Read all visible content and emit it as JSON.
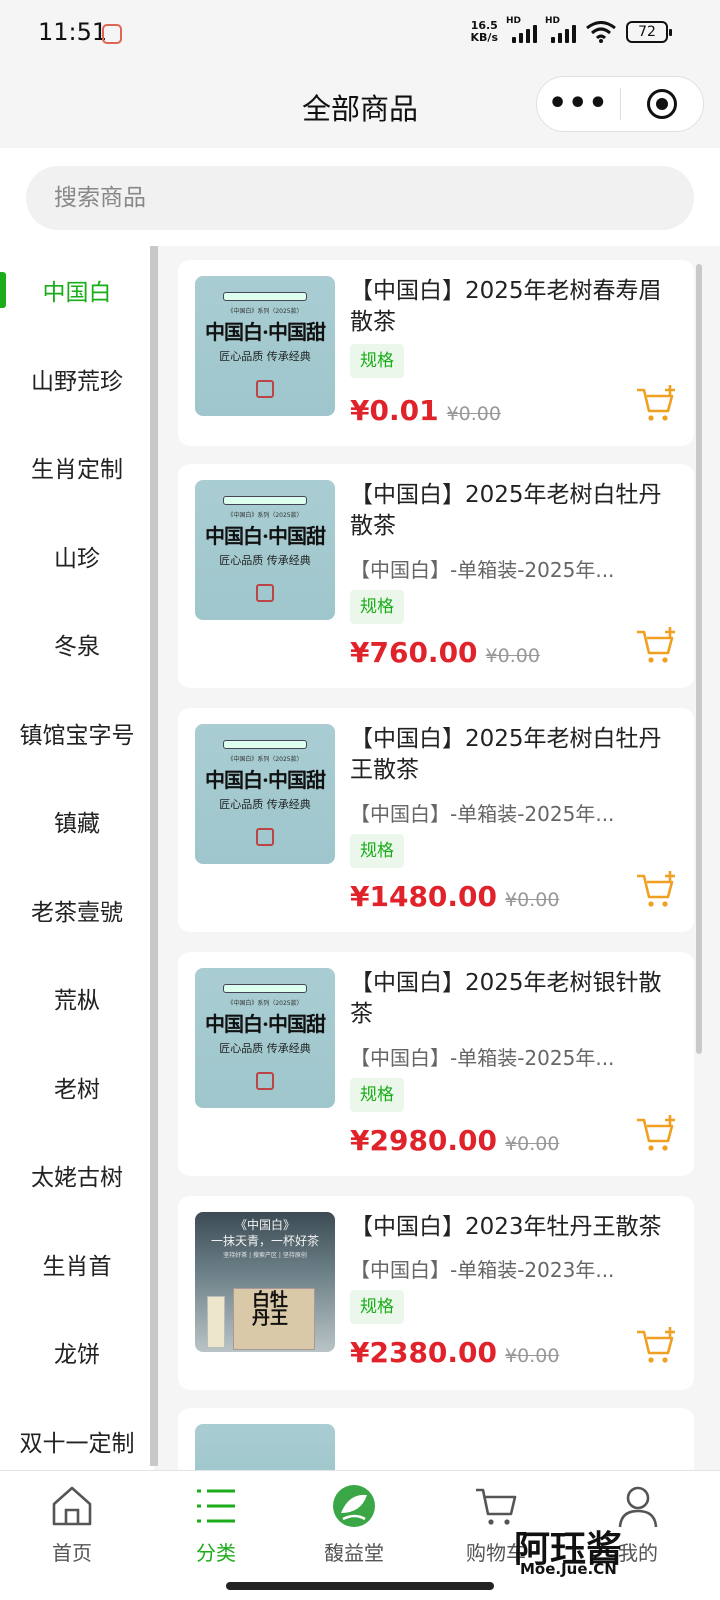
{
  "status_bar": {
    "time": "11:51",
    "net_speed_top": "16.5",
    "net_speed_bottom": "KB/s",
    "hd1": "HD",
    "hd2": "HD",
    "battery": "72"
  },
  "nav": {
    "title": "全部商品",
    "more_icon": "more-dots-icon",
    "close_icon": "target-icon"
  },
  "search": {
    "placeholder": "搜索商品"
  },
  "sidebar": {
    "items": [
      {
        "label": "中国白",
        "active": true
      },
      {
        "label": "山野荒珍"
      },
      {
        "label": "生肖定制"
      },
      {
        "label": "山珍"
      },
      {
        "label": "冬泉"
      },
      {
        "label": "镇馆宝字号"
      },
      {
        "label": "镇藏"
      },
      {
        "label": "老茶壹號"
      },
      {
        "label": "荒枞"
      },
      {
        "label": "老树"
      },
      {
        "label": "太姥古树"
      },
      {
        "label": "生肖首"
      },
      {
        "label": "龙饼"
      },
      {
        "label": "双十一定制"
      }
    ]
  },
  "thumb_text": {
    "banner": "第十届...纪念茶",
    "series": "《中国白》系列（2025款）",
    "main": "中国白·中国甜",
    "tagline": "匠心品质 传承经典",
    "dark_title": "《中国白》",
    "dark_slogan": "一抹天青，一杯好茶",
    "dark_small": "坚持好茶 | 搜索产区 | 坚持原创",
    "dark_box": "白牡丹王"
  },
  "products": [
    {
      "title": "【中国白】2025年老树春寿眉散茶",
      "desc": "",
      "spec": "规格",
      "price": "¥0.01",
      "orig": "¥0.00"
    },
    {
      "title": "【中国白】2025年老树白牡丹散茶",
      "desc": "【中国白】-单箱装-2025年...",
      "spec": "规格",
      "price": "¥760.00",
      "orig": "¥0.00"
    },
    {
      "title": "【中国白】2025年老树白牡丹王散茶",
      "desc": "【中国白】-单箱装-2025年...",
      "spec": "规格",
      "price": "¥1480.00",
      "orig": "¥0.00"
    },
    {
      "title": "【中国白】2025年老树银针散茶",
      "desc": "【中国白】-单箱装-2025年...",
      "spec": "规格",
      "price": "¥2980.00",
      "orig": "¥0.00"
    },
    {
      "title": "【中国白】2023年牡丹王散茶",
      "desc": "【中国白】-单箱装-2023年...",
      "spec": "规格",
      "price": "¥2380.00",
      "orig": "¥0.00"
    }
  ],
  "tabs": [
    {
      "label": "首页",
      "icon": "home-icon"
    },
    {
      "label": "分类",
      "icon": "category-list-icon",
      "active": true
    },
    {
      "label": "馥益堂",
      "icon": "leaf-logo-icon"
    },
    {
      "label": "购物车",
      "icon": "cart-icon"
    },
    {
      "label": "我的",
      "icon": "user-icon"
    }
  ],
  "watermark": {
    "text": "阿珏酱",
    "sub": "Moe.Jue.CN"
  },
  "colors": {
    "accent": "#1aad19",
    "price": "#e0222a",
    "cart": "#f0a020"
  }
}
